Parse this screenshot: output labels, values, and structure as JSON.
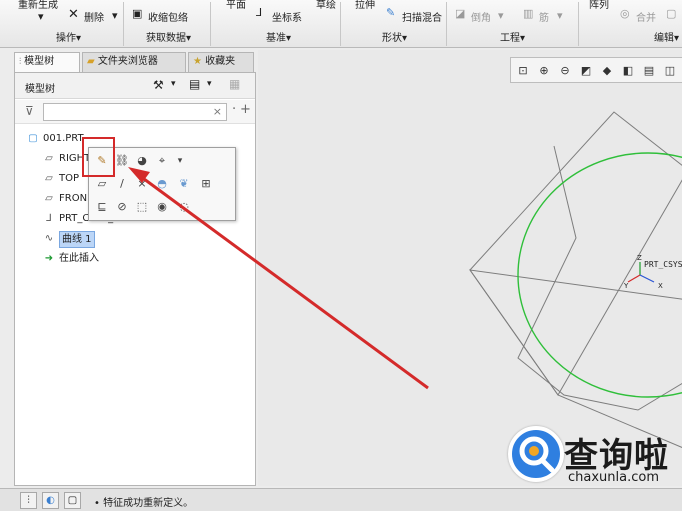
{
  "ribbon": {
    "top_labels": [
      "重新生成",
      "平面",
      "草绘",
      "拉伸",
      "阵列"
    ],
    "buttons": {
      "delete": "删除",
      "shrinkwrap": "收缩包络",
      "csys": "坐标系",
      "sweep_blend": "扫描混合",
      "round": "倒角",
      "rib": "筋",
      "merge": "合并"
    },
    "groups": [
      "操作▾",
      "获取数据▾",
      "基准▾",
      "形状▾",
      "工程▾",
      "编辑▾"
    ]
  },
  "tabs": [
    {
      "label": "模型树"
    },
    {
      "label": "文件夹浏览器"
    },
    {
      "label": "收藏夹"
    }
  ],
  "tree": {
    "title": "模型树",
    "filter_clear": "×",
    "items": [
      {
        "label": "001.PRT",
        "icon": "part-icon"
      },
      {
        "label": "RIGHT",
        "icon": "datum-plane-icon"
      },
      {
        "label": "TOP",
        "icon": "datum-plane-icon"
      },
      {
        "label": "FRON",
        "icon": "datum-plane-icon"
      },
      {
        "label": "PRT_CSYS_DEF",
        "icon": "csys-icon"
      },
      {
        "label": "曲线 1",
        "icon": "curve-icon"
      },
      {
        "label": "在此插入",
        "icon": "insert-arrow-icon"
      }
    ]
  },
  "graphics": {
    "csys_label": "PRT_CSYS",
    "axis_z": "Z",
    "axis_y": "Y",
    "axis_x": "X",
    "circle_color": "#2fbf3a",
    "arrow_color": "#d42a2a"
  },
  "status": {
    "message": "• 特征成功重新定义。"
  },
  "watermark": {
    "cn": "查询啦",
    "en": "chaxunla.com"
  }
}
